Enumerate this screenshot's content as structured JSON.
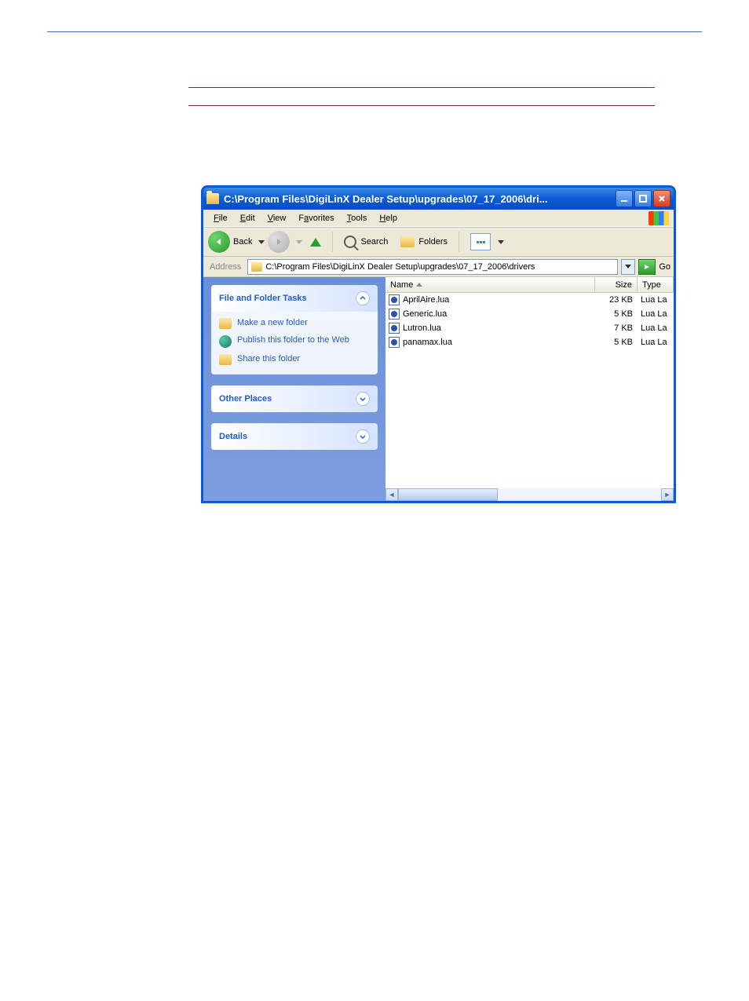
{
  "window": {
    "title": "C:\\Program Files\\DigiLinX Dealer Setup\\upgrades\\07_17_2006\\dri..."
  },
  "menubar": {
    "file": "File",
    "edit": "Edit",
    "view": "View",
    "favorites": "Favorites",
    "tools": "Tools",
    "help": "Help"
  },
  "toolbar": {
    "back": "Back",
    "search": "Search",
    "folders": "Folders"
  },
  "address_bar": {
    "label": "Address",
    "path": "C:\\Program Files\\DigiLinX Dealer Setup\\upgrades\\07_17_2006\\drivers",
    "go": "Go"
  },
  "side_panel": {
    "file_folder_tasks": {
      "title": "File and Folder Tasks",
      "items": [
        "Make a new folder",
        "Publish this folder to the Web",
        "Share this folder"
      ]
    },
    "other_places": {
      "title": "Other Places"
    },
    "details": {
      "title": "Details"
    }
  },
  "file_list": {
    "columns": {
      "name": "Name",
      "size": "Size",
      "type": "Type"
    },
    "rows": [
      {
        "name": "AprilAire.lua",
        "size": "23 KB",
        "type": "Lua La"
      },
      {
        "name": "Generic.lua",
        "size": "5 KB",
        "type": "Lua La"
      },
      {
        "name": "Lutron.lua",
        "size": "7 KB",
        "type": "Lua La"
      },
      {
        "name": "panamax.lua",
        "size": "5 KB",
        "type": "Lua La"
      }
    ]
  }
}
